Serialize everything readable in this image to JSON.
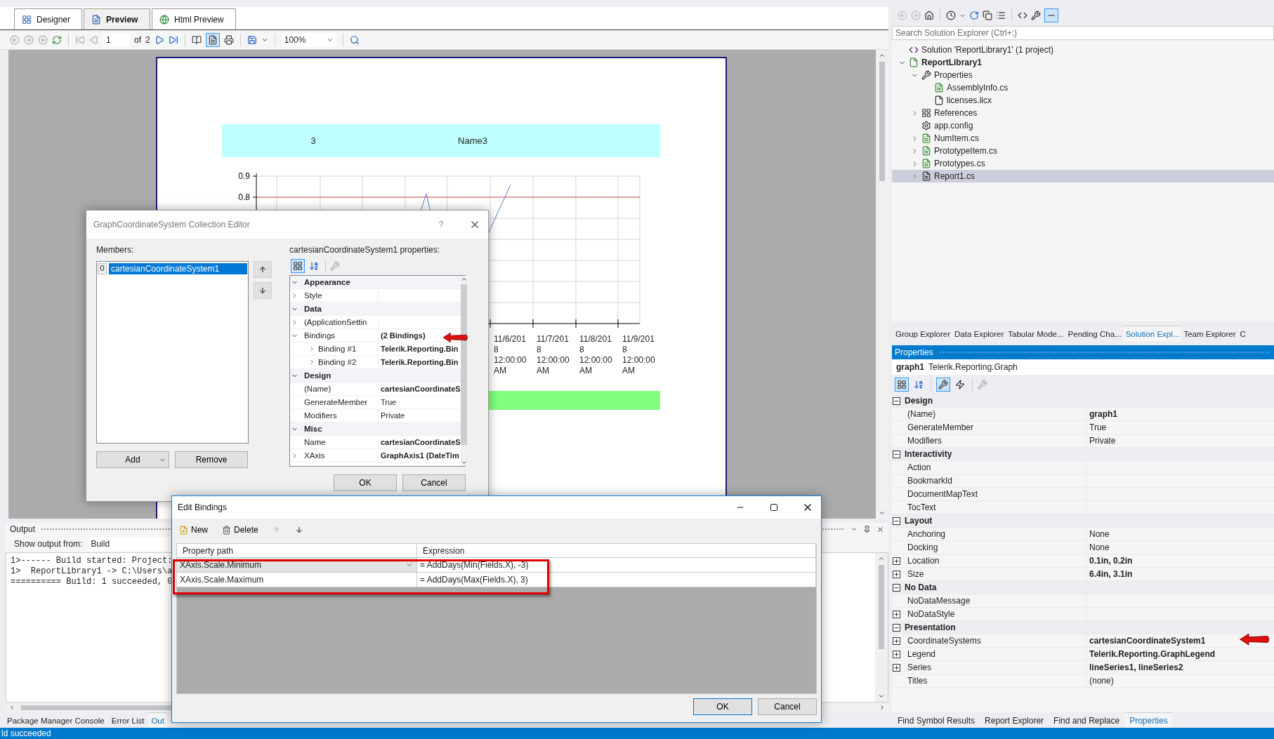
{
  "document_tabs": [
    {
      "label": "Designer",
      "kind": "designer",
      "selected": false
    },
    {
      "label": "Preview",
      "kind": "preview",
      "selected": true
    },
    {
      "label": "Html Preview",
      "kind": "html",
      "selected": false
    }
  ],
  "preview_toolbar": {
    "page": "1",
    "of_label": "of",
    "page_count": "2",
    "zoom": "100%"
  },
  "report": {
    "header_cells": [
      "3",
      "Name3"
    ],
    "chart": {
      "y_ticks": [
        "0.9",
        "0.8"
      ],
      "x_labels": [
        "11/6/2018 12:00:00 AM",
        "11/7/2018 12:00:00 AM",
        "11/8/2018 12:00:00 AM",
        "11/9/2018 12:00:00 AM"
      ]
    }
  },
  "output": {
    "title": "Output",
    "source_label": "Show output from:",
    "source": "Build",
    "lines": [
      "1>------ Build started: Project:",
      "1>  ReportLibrary1 -> C:\\Users\\a",
      "========== Build: 1 succeeded, 0"
    ]
  },
  "left_bottom_tabs": [
    {
      "label": "Package Manager Console",
      "selected": false
    },
    {
      "label": "Error List",
      "selected": false
    },
    {
      "label": "Out",
      "selected": true
    }
  ],
  "solution_explorer": {
    "search_placeholder": "Search Solution Explorer (Ctrl+;)",
    "tree": [
      {
        "label": "Solution 'ReportLibrary1' (1 project)",
        "kind": "solution",
        "selected": false,
        "children": [
          {
            "label": "ReportLibrary1",
            "kind": "project",
            "expanded": true,
            "selected": false,
            "children": [
              {
                "label": "Properties",
                "kind": "wrench",
                "expanded": true,
                "selected": false,
                "children": [
                  {
                    "label": "AssemblyInfo.cs",
                    "kind": "cs",
                    "selected": false
                  },
                  {
                    "label": "licenses.licx",
                    "kind": "file",
                    "selected": false
                  }
                ]
              },
              {
                "label": "References",
                "kind": "references",
                "expanded": false,
                "selected": false
              },
              {
                "label": "app.config",
                "kind": "config",
                "selected": false
              },
              {
                "label": "NumItem.cs",
                "kind": "cs",
                "expanded": false,
                "selected": false
              },
              {
                "label": "PrototypeItem.cs",
                "kind": "cs",
                "expanded": false,
                "selected": false
              },
              {
                "label": "Prototypes.cs",
                "kind": "cs",
                "expanded": false,
                "selected": false
              },
              {
                "label": "Report1.cs",
                "kind": "report",
                "expanded": false,
                "selected": true
              }
            ]
          }
        ]
      }
    ]
  },
  "right_tabs": [
    {
      "label": "Group Explorer",
      "selected": false
    },
    {
      "label": "Data Explorer",
      "selected": false
    },
    {
      "label": "Tabular Mode...",
      "selected": false
    },
    {
      "label": "Pending Cha...",
      "selected": false
    },
    {
      "label": "Solution Expl...",
      "selected": true
    },
    {
      "label": "Team Explorer",
      "selected": false
    },
    {
      "label": "C",
      "selected": false
    }
  ],
  "properties": {
    "title": "Properties",
    "object_name": "graph1",
    "object_type": "Telerik.Reporting.Graph",
    "categories": [
      {
        "name": "Design",
        "expanded": true,
        "rows": [
          {
            "name": "(Name)",
            "value": "graph1",
            "modified": true
          },
          {
            "name": "GenerateMember",
            "value": "True",
            "modified": false
          },
          {
            "name": "Modifiers",
            "value": "Private",
            "modified": false
          }
        ]
      },
      {
        "name": "Interactivity",
        "expanded": true,
        "rows": [
          {
            "name": "Action"
          },
          {
            "name": "BookmarkId"
          },
          {
            "name": "DocumentMapText"
          },
          {
            "name": "TocText"
          }
        ]
      },
      {
        "name": "Layout",
        "expanded": true,
        "rows": [
          {
            "name": "Anchoring",
            "value": "None",
            "modified": false
          },
          {
            "name": "Docking",
            "value": "None",
            "modified": false
          },
          {
            "name": "Location",
            "value": "0.1in, 0.2in",
            "expanded": false,
            "modified": true
          },
          {
            "name": "Size",
            "value": "6.4in, 3.1in",
            "expanded": false,
            "modified": true
          }
        ]
      },
      {
        "name": "No Data",
        "expanded": true,
        "rows": [
          {
            "name": "NoDataMessage"
          },
          {
            "name": "NoDataStyle",
            "expanded": false
          }
        ]
      },
      {
        "name": "Presentation",
        "expanded": true,
        "rows": [
          {
            "name": "CoordinateSystems",
            "value": "cartesianCoordinateSystem1",
            "expanded": false,
            "modified": true
          },
          {
            "name": "Legend",
            "value": "Telerik.Reporting.GraphLegend",
            "expanded": false,
            "modified": true
          },
          {
            "name": "Series",
            "value": "lineSeries1, lineSeries2",
            "expanded": false,
            "modified": true
          },
          {
            "name": "Titles",
            "value": "(none)",
            "modified": false
          }
        ]
      }
    ]
  },
  "right_bottom_tabs": [
    {
      "label": "Find Symbol Results",
      "selected": false
    },
    {
      "label": "Report Explorer",
      "selected": false
    },
    {
      "label": "Find and Replace",
      "selected": false
    },
    {
      "label": "Properties",
      "selected": true
    }
  ],
  "status_bar": "ld succeeded",
  "collection_editor": {
    "title": "GraphCoordinateSystem Collection Editor",
    "help": "?",
    "members_label": "Members:",
    "members": [
      {
        "index": "0",
        "name": "cartesianCoordinateSystem1",
        "selected": true
      }
    ],
    "add_button": "Add",
    "remove_button": "Remove",
    "properties_label": "cartesianCoordinateSystem1 properties:",
    "grid": [
      {
        "name": "Appearance",
        "expanded": true,
        "rows": [
          {
            "name": "Style",
            "expanded": false
          }
        ]
      },
      {
        "name": "Data",
        "expanded": true,
        "rows": [
          {
            "name": "(ApplicationSettin",
            "expanded": false
          },
          {
            "name": "Bindings",
            "value": "(2 Bindings)",
            "expanded": true,
            "modified": true,
            "children": [
              {
                "name": "Binding #1",
                "value": "Telerik.Reporting.Bin",
                "expanded": false,
                "modified": true
              },
              {
                "name": "Binding #2",
                "value": "Telerik.Reporting.Bin",
                "expanded": false,
                "modified": true
              }
            ]
          }
        ]
      },
      {
        "name": "Design",
        "expanded": true,
        "rows": [
          {
            "name": "(Name)",
            "value": "cartesianCoordinateS",
            "modified": true
          },
          {
            "name": "GenerateMember",
            "value": "True",
            "modified": false
          },
          {
            "name": "Modifiers",
            "value": "Private",
            "modified": false
          }
        ]
      },
      {
        "name": "Misc",
        "expanded": true,
        "rows": [
          {
            "name": "Name",
            "value": "cartesianCoordinateS",
            "modified": true
          },
          {
            "name": "XAxis",
            "value": "GraphAxis1 (DateTim",
            "expanded": false,
            "modified": true
          }
        ]
      }
    ],
    "ok": "OK",
    "cancel": "Cancel"
  },
  "edit_bindings": {
    "title": "Edit Bindings",
    "new": "New",
    "delete": "Delete",
    "columns": [
      "Property path",
      "Expression"
    ],
    "rows": [
      {
        "property_path": "XAxis.Scale.Minimum",
        "expression": "= AddDays(Min(Fields.X), -3)",
        "selected": true
      },
      {
        "property_path": "XAxis.Scale.Maximum",
        "expression": "= AddDays(Max(Fields.X), 3)",
        "selected": false
      }
    ],
    "ok": "OK",
    "cancel": "Cancel"
  }
}
